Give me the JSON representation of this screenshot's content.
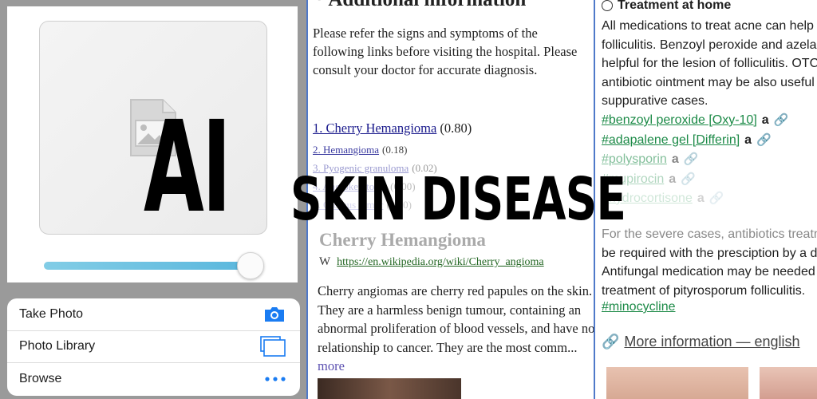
{
  "overlay": {
    "ai": "AI",
    "title": "SKIN DISEASE"
  },
  "uploader": {
    "zoom_fraction": 0.94
  },
  "action_sheet": {
    "take_photo": "Take Photo",
    "photo_library": "Photo Library",
    "browse": "Browse",
    "accent_color": "#1a7cf2"
  },
  "info": {
    "heading": "* Additional information",
    "intro": "Please refer the signs and symptoms of the following links before visiting the hospital. Please consult your doctor for accurate diagnosis.",
    "results": [
      {
        "name": "1. Cherry Hemangioma",
        "score": "(0.80)"
      },
      {
        "name": "2. Hemangioma",
        "score": "(0.18)"
      },
      {
        "name": "3. Pyogenic granuloma",
        "score": "(0.02)"
      },
      {
        "name": "4. Angiokeratoma",
        "score": "(0.00)"
      },
      {
        "name": "5. Glomus tumor",
        "score": "(0.00)"
      }
    ],
    "article_title": "Cherry Hemangioma",
    "wiki_icon": "W",
    "wiki_url": "https://en.wikipedia.org/wiki/Cherry_angioma",
    "article_body": "Cherry angiomas are cherry red papules on the skin. They are a harmless benign tumour, containing an abnormal proliferation of blood vessels, and have no relationship to cancer. They are the most comm...",
    "more_label": "more"
  },
  "treatment": {
    "heading": "Treatment at home",
    "text_lines": [
      "All medications to treat acne can help",
      "folliculitis. Benzoyl peroxide and azelaic",
      "helpful for the lesion of folliculitis. OTC",
      "antibiotic ointment may be also useful in",
      "suppurative cases."
    ],
    "tags": [
      {
        "label": "#benzoyl peroxide [Oxy-10]",
        "amazon": "a",
        "link_icon": "link-icon"
      },
      {
        "label": "#adapalene gel [Differin]",
        "amazon": "a",
        "link_icon": "link-icon"
      },
      {
        "label": "#polysporin",
        "amazon": "a",
        "link_icon": "link-icon"
      },
      {
        "label": "#mupirocin",
        "amazon": "a",
        "link_icon": "link-icon"
      },
      {
        "label": "#hydrocortisone",
        "amazon": "a",
        "link_icon": "link-icon"
      }
    ],
    "severe_lines": [
      "For the severe cases, antibiotics treatment may",
      "be required with the presciption by a doctor.",
      "Antifungal medication may be needed for the",
      "treatment of pityrosporum folliculitis."
    ],
    "minocycline": "#minocycline",
    "more_info": "More information — english"
  }
}
